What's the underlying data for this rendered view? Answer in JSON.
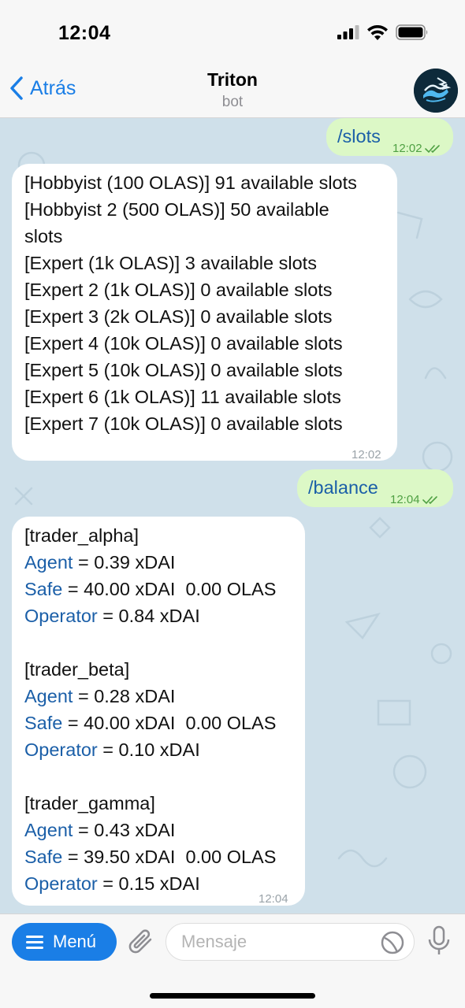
{
  "status_bar": {
    "time": "12:04",
    "icons": [
      "signal-icon",
      "wifi-icon",
      "battery-icon"
    ]
  },
  "header": {
    "back_label": "Atrás",
    "title": "Triton",
    "subtitle": "bot",
    "avatar_icon": "triton-wave-logo"
  },
  "messages": {
    "slots_cmd": {
      "text": "/slots",
      "time": "12:02"
    },
    "slots_reply": {
      "lines": [
        "[Hobbyist (100 OLAS)] 91 available slots",
        "[Hobbyist 2 (500 OLAS)] 50 available",
        "slots",
        "[Expert (1k OLAS)] 3 available slots",
        "[Expert 2 (1k OLAS)] 0 available slots",
        "[Expert 3 (2k OLAS)] 0 available slots",
        "[Expert 4 (10k OLAS)] 0 available slots",
        "[Expert 5 (10k OLAS)] 0 available slots",
        "[Expert 6 (1k OLAS)] 11 available slots",
        "[Expert 7 (10k OLAS)] 0 available slots"
      ],
      "time": "12:02"
    },
    "balance_cmd": {
      "text": "/balance",
      "time": "12:04"
    },
    "balance_reply": {
      "traders": [
        {
          "name": "[trader_alpha]",
          "agent_label": "Agent",
          "agent_value": " = 0.39 xDAI",
          "safe_label": "Safe",
          "safe_value": " = 40.00 xDAI  0.00 OLAS",
          "operator_label": "Operator",
          "operator_value": " = 0.84 xDAI"
        },
        {
          "name": "[trader_beta]",
          "agent_label": "Agent",
          "agent_value": " = 0.28 xDAI",
          "safe_label": "Safe",
          "safe_value": " = 40.00 xDAI  0.00 OLAS",
          "operator_label": "Operator",
          "operator_value": " = 0.10 xDAI"
        },
        {
          "name": "[trader_gamma]",
          "agent_label": "Agent",
          "agent_value": " = 0.43 xDAI",
          "safe_label": "Safe",
          "safe_value": " = 39.50 xDAI  0.00 OLAS",
          "operator_label": "Operator",
          "operator_value": " = 0.15 xDAI"
        }
      ],
      "time": "12:04"
    }
  },
  "input_bar": {
    "menu_label": "Menú",
    "placeholder": "Mensaje"
  },
  "colors": {
    "accent": "#1a7ee6",
    "outgoing_bubble": "#dcf8c6",
    "chat_bg": "#cfe0ea"
  }
}
